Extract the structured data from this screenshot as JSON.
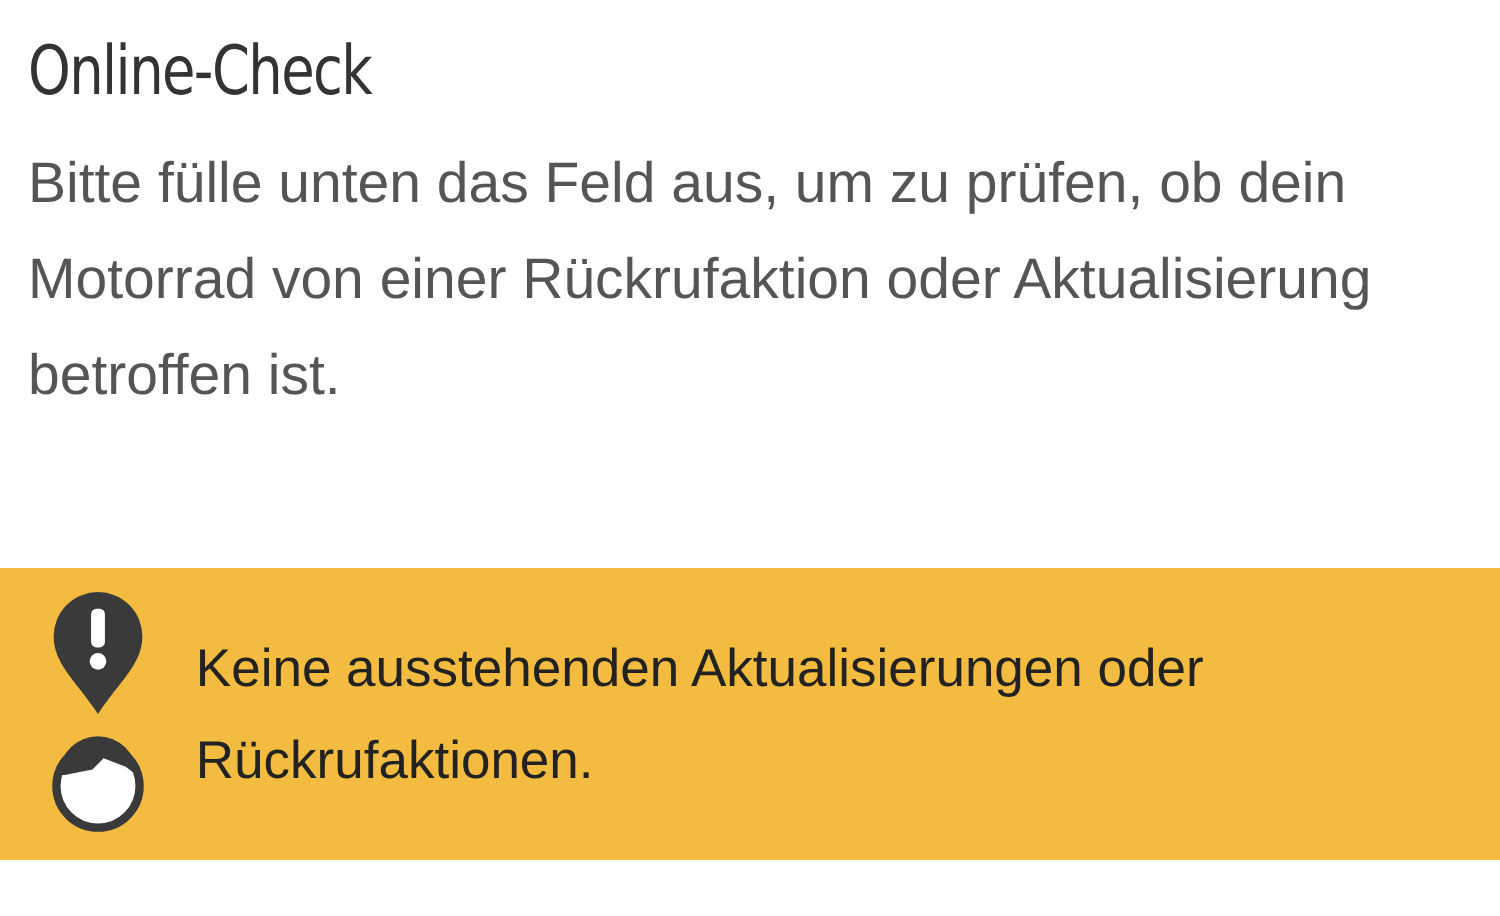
{
  "title": "Online-Check",
  "description": "Bitte fülle unten das Feld aus, um zu prüfen, ob dein Motorrad von einer Rückrufaktion oder Aktualisierung betroffen ist.",
  "notice": {
    "kind": "warning",
    "message": "Keine ausstehenden Aktualisierungen oder Rückrufaktionen."
  }
}
